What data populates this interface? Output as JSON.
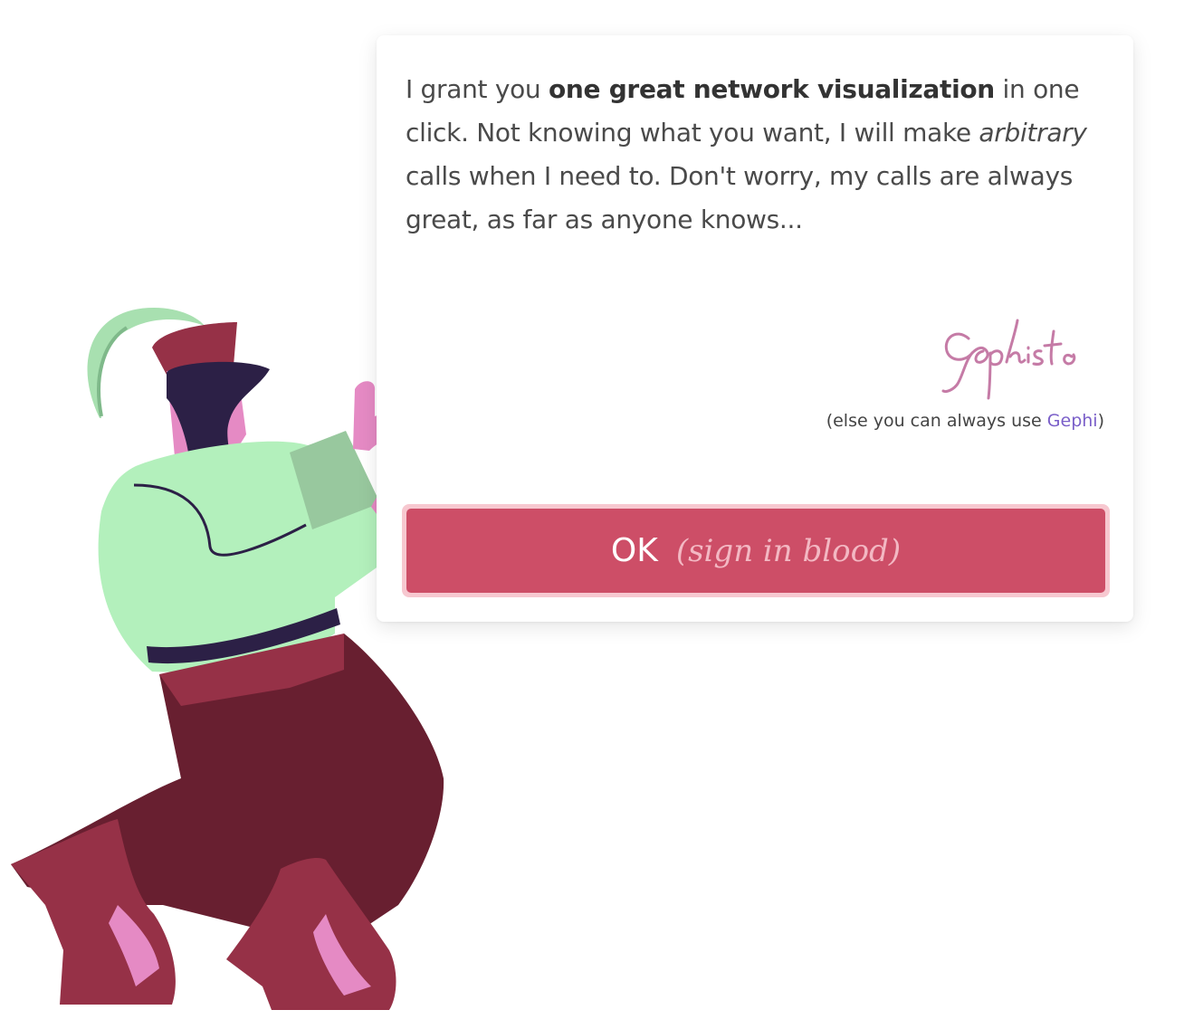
{
  "dialog": {
    "message": {
      "part1": "I grant you ",
      "bold": "one great network visualization",
      "part2": " in one click. Not knowing what you want, I will make ",
      "italic": "arbitrary",
      "part3": " calls when I need to. Don't worry, my calls are always great, as far as anyone knows..."
    },
    "signature": "Gephisto",
    "note": {
      "prefix": "(else you can always use ",
      "link": "Gephi",
      "suffix": ")"
    },
    "ok_button": {
      "label": "OK",
      "sublabel": "(sign in blood)"
    }
  },
  "colors": {
    "button": "#cd4e67",
    "button_outline": "#f7c8d0",
    "link": "#7a5fc9",
    "signature": "#c57ba6"
  }
}
